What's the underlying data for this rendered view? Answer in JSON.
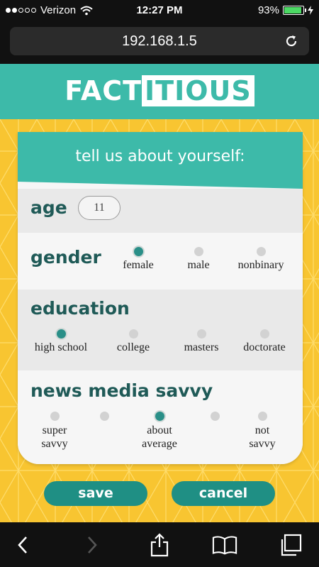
{
  "status": {
    "carrier": "Verizon",
    "time": "12:27 PM",
    "battery": "93%",
    "battery_level": 0.93
  },
  "browser": {
    "url": "192.168.1.5"
  },
  "logo": {
    "part1": "FACT",
    "part2": "ITIOUS"
  },
  "form": {
    "title": "tell us about yourself:",
    "age": {
      "label": "age",
      "value": "11"
    },
    "gender": {
      "label": "gender",
      "options": [
        "female",
        "male",
        "nonbinary"
      ],
      "selected": "female"
    },
    "education": {
      "label": "education",
      "options": [
        "high school",
        "college",
        "masters",
        "doctorate"
      ],
      "selected": "high school"
    },
    "savvy": {
      "label": "news media savvy",
      "options": [
        {
          "line1": "super",
          "line2": "savvy"
        },
        {
          "line1": "",
          "line2": ""
        },
        {
          "line1": "about",
          "line2": "average"
        },
        {
          "line1": "",
          "line2": ""
        },
        {
          "line1": "not",
          "line2": "savvy"
        }
      ],
      "selected_index": 2
    }
  },
  "buttons": {
    "save": "save",
    "cancel": "cancel"
  },
  "colors": {
    "teal": "#3dbaa9",
    "dark_teal": "#1f8f84",
    "yellow": "#f8c531"
  }
}
